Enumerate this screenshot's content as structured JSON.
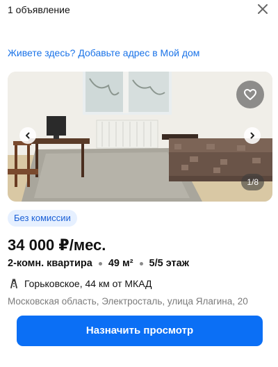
{
  "header": {
    "title": "1 объявление",
    "close_icon": "close-icon"
  },
  "home_link": "Живете здесь? Добавьте адрес в Мой дом",
  "gallery": {
    "counter": "1/8",
    "favorite_icon": "heart-icon",
    "prev_icon": "chevron-left-icon",
    "next_icon": "chevron-right-icon"
  },
  "listing": {
    "badge": "Без комиссии",
    "price": "34 000 ₽/мес.",
    "rooms": "2-комн. квартира",
    "area": "49 м²",
    "floor": "5/5 этаж",
    "road_icon": "road-icon",
    "road": "Горьковское, 44 км от МКАД",
    "address": "Московская область, Электросталь, улица Ялагина, 20"
  },
  "cta": {
    "label": "Назначить просмотр"
  },
  "colors": {
    "accent": "#0b6ff5",
    "link": "#1a73e8",
    "badge_bg": "#e6f0ff",
    "muted": "#7a7a7a"
  }
}
